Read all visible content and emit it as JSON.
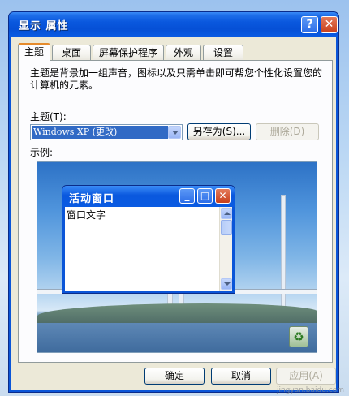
{
  "window": {
    "title": "显示 属性",
    "help_label": "?",
    "close_label": "✕"
  },
  "tabs": [
    {
      "label": "主题",
      "active": true
    },
    {
      "label": "桌面",
      "active": false
    },
    {
      "label": "屏幕保护程序",
      "active": false
    },
    {
      "label": "外观",
      "active": false
    },
    {
      "label": "设置",
      "active": false
    }
  ],
  "themes_panel": {
    "description": "主题是背景加一组声音，图标以及只需单击即可帮您个性化设置您的计算机的元素。",
    "theme_label": "主题(T):",
    "theme_value": "Windows XP (更改)",
    "save_as_label": "另存为(S)...",
    "delete_label": "删除(D)",
    "sample_label": "示例:"
  },
  "sample_window": {
    "title": "活动窗口",
    "body_text": "窗口文字"
  },
  "footer": {
    "ok_label": "确定",
    "cancel_label": "取消",
    "apply_label": "应用(A)"
  },
  "watermark": "jingyan.baidu.com",
  "colors": {
    "title_bar": "#0a58de",
    "selection": "#316ac5",
    "active_tab_accent": "#e68b2c",
    "dialog_face": "#ece9d8"
  },
  "icons": {
    "recycle_bin": "recycle-bin-icon"
  }
}
